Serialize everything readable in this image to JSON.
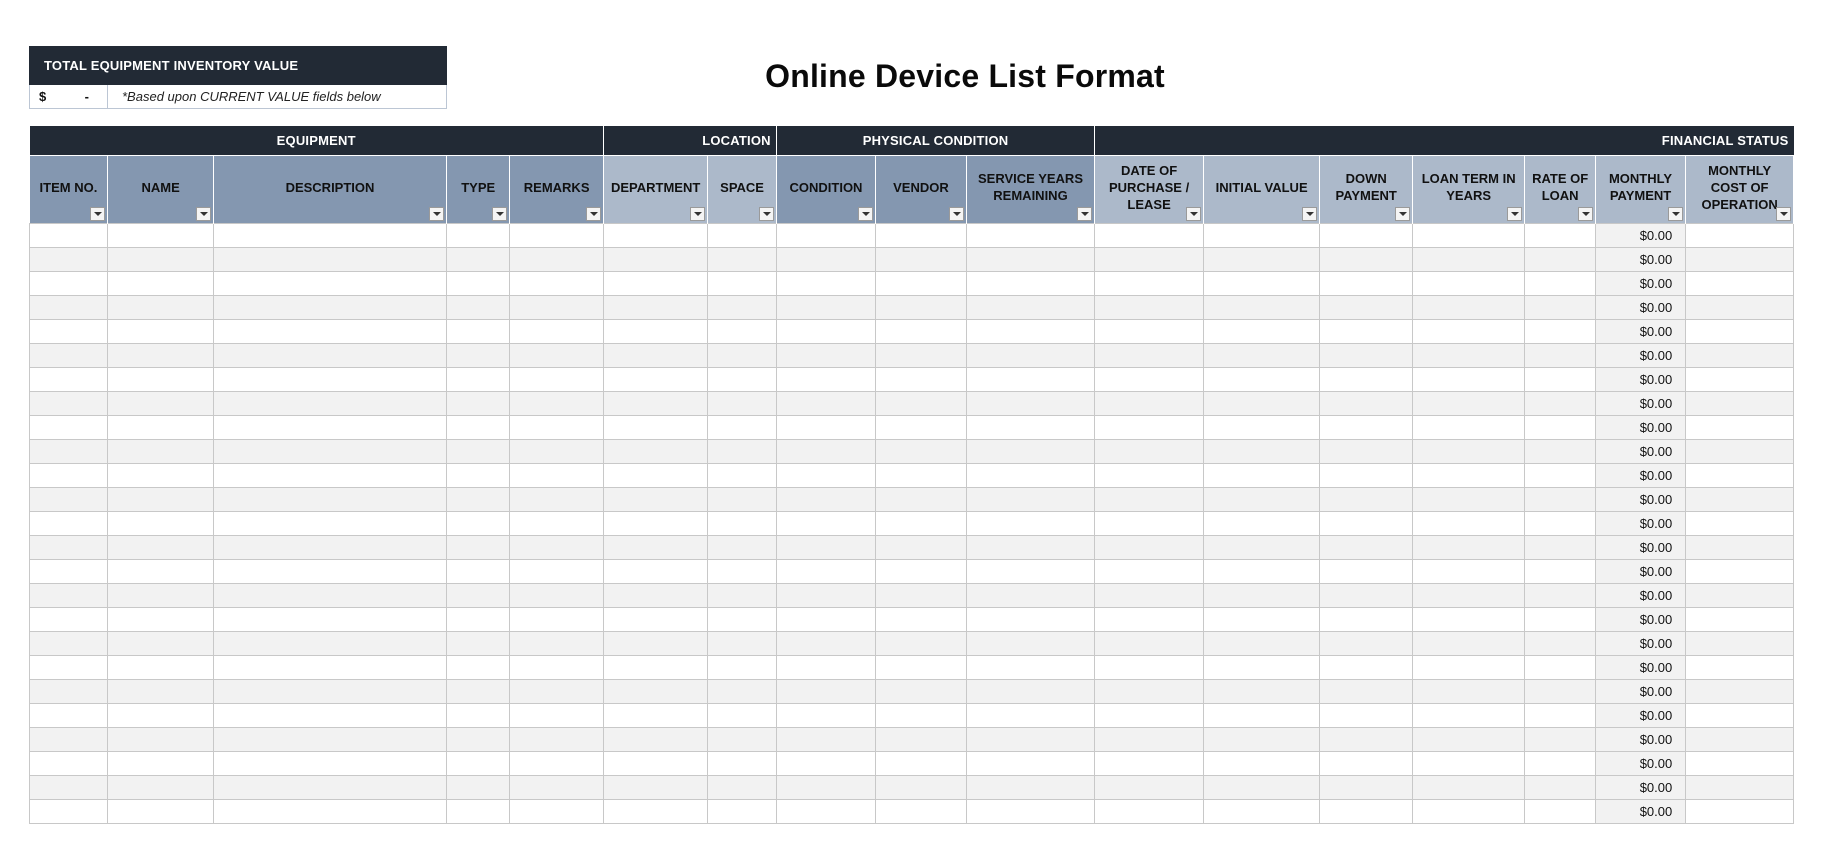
{
  "summary": {
    "header": "TOTAL EQUIPMENT INVENTORY VALUE",
    "currency_symbol": "$",
    "value": "-",
    "note": "*Based upon CURRENT VALUE fields below"
  },
  "title": "Online Device List Format",
  "groups": [
    {
      "label": "EQUIPMENT",
      "span": 5,
      "align": "center"
    },
    {
      "label": "LOCATION",
      "span": 2,
      "align": "right"
    },
    {
      "label": "PHYSICAL CONDITION",
      "span": 3,
      "align": "center"
    },
    {
      "label": "FINANCIAL STATUS",
      "span": 7,
      "align": "right"
    }
  ],
  "columns": [
    {
      "key": "item_no",
      "label": "ITEM NO.",
      "shade": "a"
    },
    {
      "key": "name",
      "label": "NAME",
      "shade": "a"
    },
    {
      "key": "description",
      "label": "DESCRIPTION",
      "shade": "a"
    },
    {
      "key": "type",
      "label": "TYPE",
      "shade": "a"
    },
    {
      "key": "remarks",
      "label": "REMARKS",
      "shade": "a"
    },
    {
      "key": "department",
      "label": "DEPARTMENT",
      "shade": "b"
    },
    {
      "key": "space",
      "label": "SPACE",
      "shade": "b"
    },
    {
      "key": "condition",
      "label": "CONDITION",
      "shade": "c"
    },
    {
      "key": "vendor",
      "label": "VENDOR",
      "shade": "c"
    },
    {
      "key": "service_years_remaining",
      "label": "SERVICE YEARS REMAINING",
      "shade": "c"
    },
    {
      "key": "date_of_purchase",
      "label": "DATE OF PURCHASE / LEASE",
      "shade": "d"
    },
    {
      "key": "initial_value",
      "label": "INITIAL VALUE",
      "shade": "d"
    },
    {
      "key": "down_payment",
      "label": "DOWN PAYMENT",
      "shade": "d"
    },
    {
      "key": "loan_term",
      "label": "LOAN TERM IN YEARS",
      "shade": "d"
    },
    {
      "key": "rate_of_loan",
      "label": "RATE OF LOAN",
      "shade": "d"
    },
    {
      "key": "monthly_payment",
      "label": "MONTHLY PAYMENT",
      "shade": "d"
    },
    {
      "key": "monthly_cost",
      "label": "MONTHLY COST OF OPERATION",
      "shade": "d"
    }
  ],
  "rows": [
    {
      "monthly_payment": "$0.00"
    },
    {
      "monthly_payment": "$0.00"
    },
    {
      "monthly_payment": "$0.00"
    },
    {
      "monthly_payment": "$0.00"
    },
    {
      "monthly_payment": "$0.00"
    },
    {
      "monthly_payment": "$0.00"
    },
    {
      "monthly_payment": "$0.00"
    },
    {
      "monthly_payment": "$0.00"
    },
    {
      "monthly_payment": "$0.00"
    },
    {
      "monthly_payment": "$0.00"
    },
    {
      "monthly_payment": "$0.00"
    },
    {
      "monthly_payment": "$0.00"
    },
    {
      "monthly_payment": "$0.00"
    },
    {
      "monthly_payment": "$0.00"
    },
    {
      "monthly_payment": "$0.00"
    },
    {
      "monthly_payment": "$0.00"
    },
    {
      "monthly_payment": "$0.00"
    },
    {
      "monthly_payment": "$0.00"
    },
    {
      "monthly_payment": "$0.00"
    },
    {
      "monthly_payment": "$0.00"
    },
    {
      "monthly_payment": "$0.00"
    },
    {
      "monthly_payment": "$0.00"
    },
    {
      "monthly_payment": "$0.00"
    },
    {
      "monthly_payment": "$0.00"
    },
    {
      "monthly_payment": "$0.00"
    }
  ],
  "colors": {
    "header_dark": "#222a35",
    "header_blue": "#8497b0",
    "header_light_blue": "#acb9ca",
    "row_stripe": "#f2f2f2"
  }
}
